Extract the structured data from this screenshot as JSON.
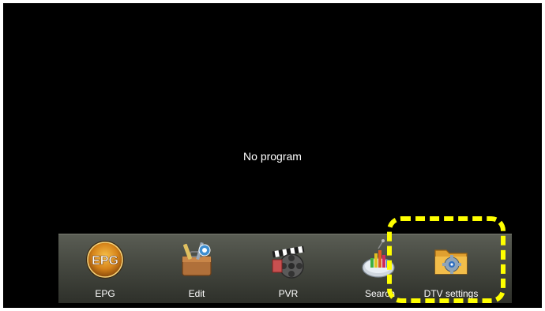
{
  "screen": {
    "status_text": "No program"
  },
  "menu": {
    "items": [
      {
        "label": "EPG",
        "icon": "epg-icon",
        "icon_text": "EPG"
      },
      {
        "label": "Edit",
        "icon": "edit-toolbox-icon"
      },
      {
        "label": "PVR",
        "icon": "pvr-film-icon"
      },
      {
        "label": "Search",
        "icon": "satellite-search-icon"
      },
      {
        "label": "DTV settings",
        "icon": "dtv-settings-folder-gear-icon"
      }
    ]
  },
  "annotation": {
    "highlight_color": "#ffff00",
    "highlighted_item": "DTV settings"
  }
}
